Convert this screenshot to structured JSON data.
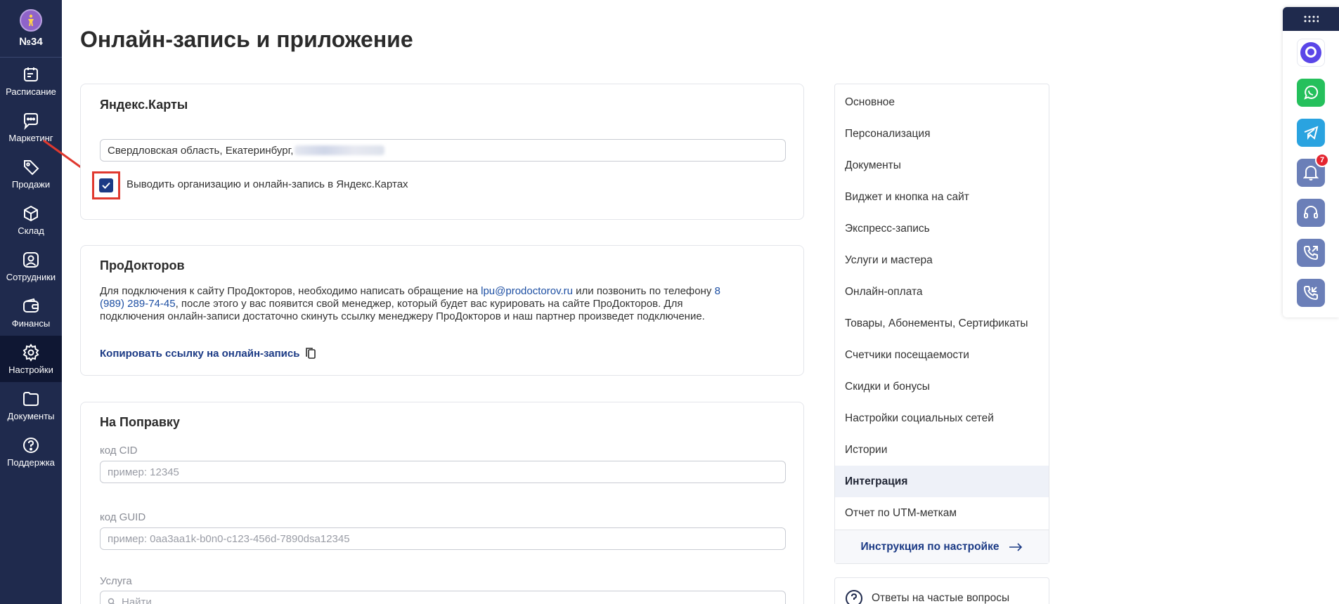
{
  "org": {
    "label": "№34"
  },
  "nav": [
    {
      "label": "Расписание",
      "icon": "calendar-icon"
    },
    {
      "label": "Маркетинг",
      "icon": "chat-bubble-icon"
    },
    {
      "label": "Продажи",
      "icon": "tag-icon"
    },
    {
      "label": "Склад",
      "icon": "box-icon"
    },
    {
      "label": "Сотрудники",
      "icon": "user-icon"
    },
    {
      "label": "Финансы",
      "icon": "wallet-icon"
    },
    {
      "label": "Настройки",
      "icon": "gear-icon"
    },
    {
      "label": "Документы",
      "icon": "folder-icon"
    },
    {
      "label": "Поддержка",
      "icon": "help-icon"
    }
  ],
  "page": {
    "title": "Онлайн-запись и приложение"
  },
  "yandex": {
    "title": "Яндекс.Карты",
    "address": "Свердловская область, Екатеринбург,",
    "checkbox_label": "Выводить организацию и онлайн-запись в Яндекс.Картах",
    "checked": true
  },
  "prodoctorov": {
    "title": "ПроДокторов",
    "text_1": "Для подключения к сайту ПроДокторов, необходимо написать обращение на ",
    "email": "lpu@prodoctorov.ru",
    "text_2": " или позвонить по телефону ",
    "phone": "8 (989) 289-74-45",
    "text_3": ", после этого у вас появится свой менеджер, который будет вас курировать на сайте ПроДокторов. Для подключения онлайн-записи достаточно скинуть ссылку менеджеру ПроДокторов и наш партнер произведет подключение.",
    "copy_link": "Копировать ссылку на онлайн-запись"
  },
  "napopravku": {
    "title": "На Поправку",
    "cid_label": "код CID",
    "cid_placeholder": "пример: 12345",
    "guid_label": "код GUID",
    "guid_placeholder": "пример: 0aa3aa1k-b0n0-c123-456d-7890dsa12345",
    "service_label": "Услуга",
    "service_placeholder": "Найти"
  },
  "menu": {
    "items": [
      "Основное",
      "Персонализация",
      "Документы",
      "Виджет и кнопка на сайт",
      "Экспресс-запись",
      "Услуги и мастера",
      "Онлайн-оплата",
      "Товары, Абонементы, Сертификаты",
      "Счетчики посещаемости",
      "Скидки и бонусы",
      "Настройки социальных сетей",
      "Истории",
      "Интеграция",
      "Отчет по UTM-меткам"
    ],
    "active": "Интеграция",
    "footer": "Инструкция по настройке"
  },
  "faq": {
    "label": "Ответы на частые вопросы"
  },
  "widgets": {
    "notification_count": "7"
  },
  "colors": {
    "sidebar": "#1f2a4d",
    "accent": "#1b3a85",
    "highlight": "#e0392f"
  }
}
